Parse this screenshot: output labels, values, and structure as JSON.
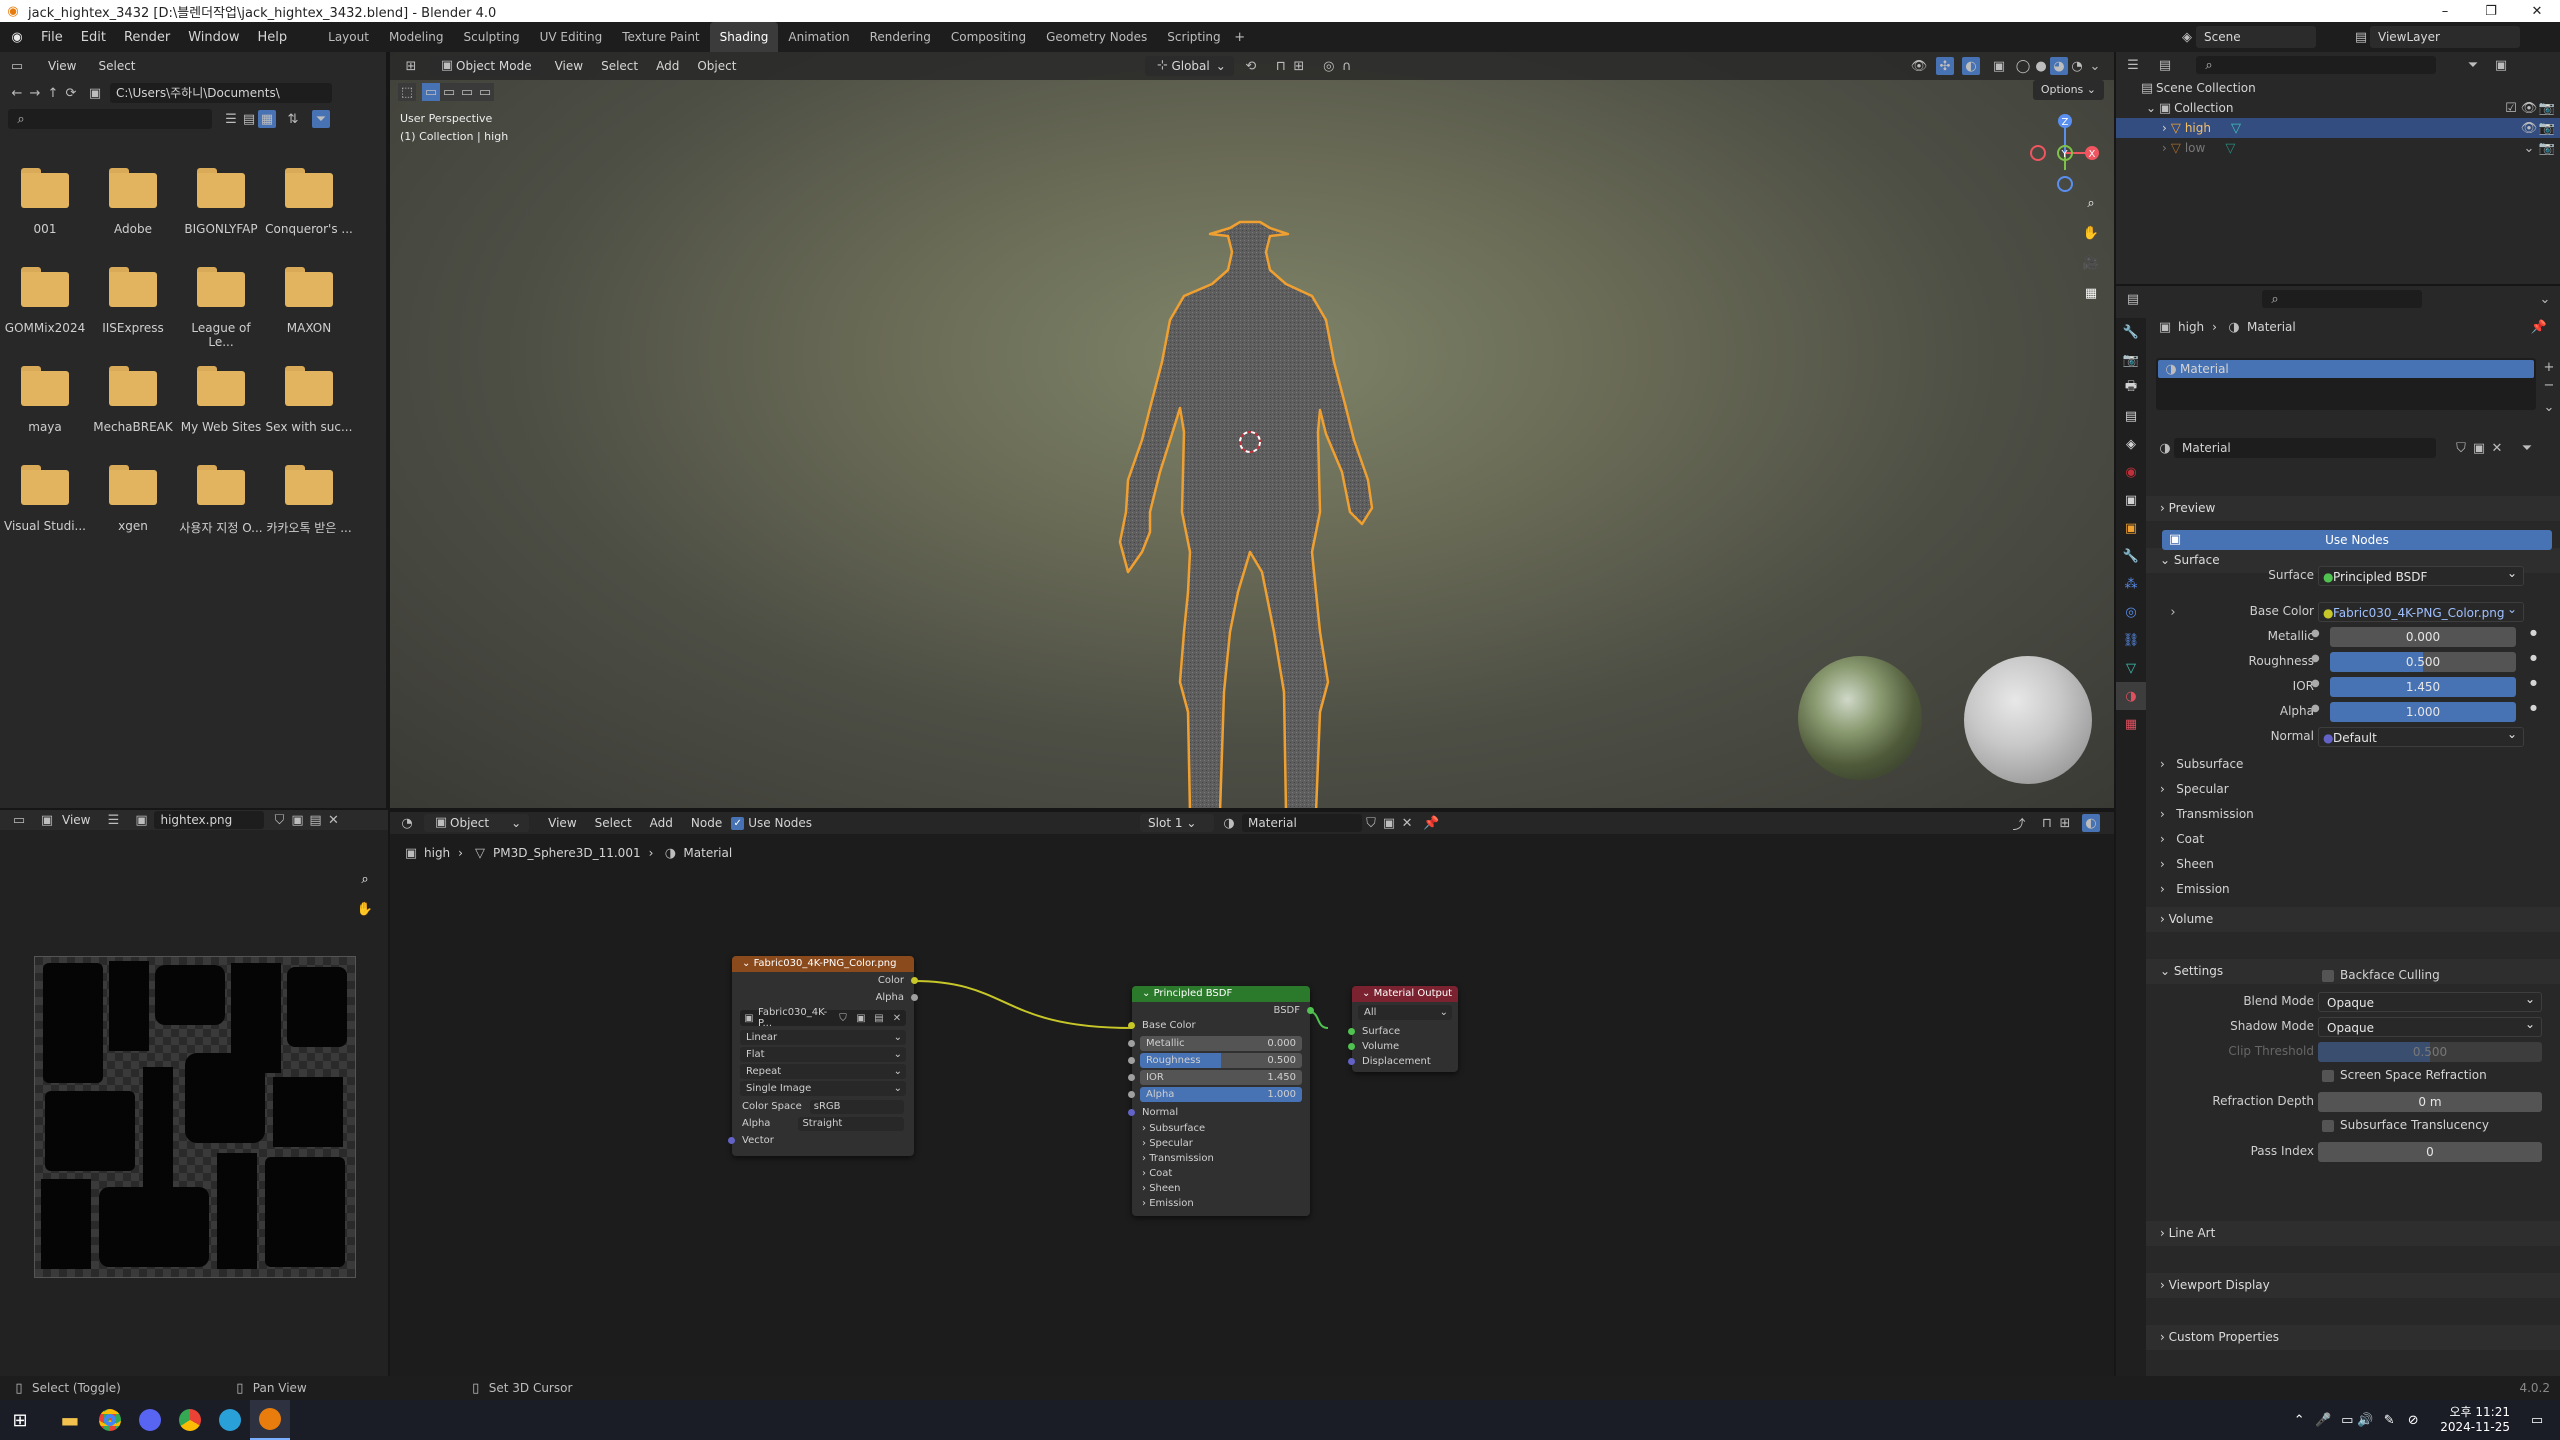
{
  "titlebar": {
    "title": "jack_hightex_3432 [D:\\블렌더작업\\jack_hightex_3432.blend] - Blender 4.0"
  },
  "menu": {
    "items": [
      "File",
      "Edit",
      "Render",
      "Window",
      "Help"
    ]
  },
  "workspaces": [
    "Layout",
    "Modeling",
    "Sculpting",
    "UV Editing",
    "Texture Paint",
    "Shading",
    "Animation",
    "Rendering",
    "Compositing",
    "Geometry Nodes",
    "Scripting"
  ],
  "active_workspace": "Shading",
  "topright": {
    "scene": "Scene",
    "view_layer": "ViewLayer"
  },
  "filebrowser": {
    "menu": [
      "View",
      "Select"
    ],
    "path": "C:\\Users\\주하니\\Documents\\",
    "folders": [
      "001",
      "Adobe",
      "BIGONLYFAP",
      "Conqueror's ...",
      "GOMMix2024",
      "IISExpress",
      "League of Le...",
      "MAXON",
      "maya",
      "MechaBREAK",
      "My Web Sites",
      "Sex with suc...",
      "Visual Studi...",
      "xgen",
      "사용자 지정 O...",
      "카카오톡 받은 ..."
    ]
  },
  "viewport": {
    "mode": "Object Mode",
    "menu": [
      "View",
      "Select",
      "Add",
      "Object"
    ],
    "transform": "Global",
    "info_line1": "User Perspective",
    "info_line2": "(1) Collection | high",
    "options": "Options",
    "gizmo": {
      "x": "X",
      "y": "Y",
      "z": "Z"
    }
  },
  "imageeditor": {
    "menu": "View",
    "image_name": "hightex.png"
  },
  "nodeeditor": {
    "mode": "Object",
    "menu": [
      "View",
      "Select",
      "Add",
      "Node"
    ],
    "use_nodes": "Use Nodes",
    "slot": "Slot 1",
    "material": "Material",
    "breadcrumb": [
      "high",
      "PM3D_Sphere3D_11.001",
      "Material"
    ],
    "image_node": {
      "title": "Fabric030_4K-PNG_Color.png",
      "out_color": "Color",
      "out_alpha": "Alpha",
      "image": "Fabric030_4K-P...",
      "interpolation": "Linear",
      "projection": "Flat",
      "extension": "Repeat",
      "source": "Single Image",
      "colorspace_label": "Color Space",
      "colorspace": "sRGB",
      "alpha_label": "Alpha",
      "alpha": "Straight",
      "in_vector": "Vector"
    },
    "bsdf_node": {
      "title": "Principled BSDF",
      "out": "BSDF",
      "base_color": "Base Color",
      "metallic_label": "Metallic",
      "metallic": "0.000",
      "roughness_label": "Roughness",
      "roughness": "0.500",
      "ior_label": "IOR",
      "ior": "1.450",
      "alpha_label": "Alpha",
      "alpha": "1.000",
      "normal": "Normal",
      "panels": [
        "Subsurface",
        "Specular",
        "Transmission",
        "Coat",
        "Sheen",
        "Emission"
      ]
    },
    "output_node": {
      "title": "Material Output",
      "target": "All",
      "surface": "Surface",
      "volume": "Volume",
      "displacement": "Displacement"
    }
  },
  "outliner": {
    "root": "Scene Collection",
    "collection": "Collection",
    "objects": [
      "high",
      "low"
    ]
  },
  "properties": {
    "breadcrumb": [
      "high",
      "Material"
    ],
    "slot_name": "Material",
    "material_name": "Material",
    "sections": {
      "preview": "Preview",
      "surface": "Surface",
      "volume": "Volume",
      "settings": "Settings",
      "line_art": "Line Art",
      "viewport_display": "Viewport Display",
      "custom_props": "Custom Properties"
    },
    "use_nodes": "Use Nodes",
    "surface_label": "Surface",
    "surface_value": "Principled BSDF",
    "base_color_label": "Base Color",
    "base_color_value": "Fabric030_4K-PNG_Color.png",
    "metallic_label": "Metallic",
    "metallic": "0.000",
    "roughness_label": "Roughness",
    "roughness": "0.500",
    "ior_label": "IOR",
    "ior": "1.450",
    "alpha_label": "Alpha",
    "alpha": "1.000",
    "normal_label": "Normal",
    "normal": "Default",
    "subpanels": [
      "Subsurface",
      "Specular",
      "Transmission",
      "Coat",
      "Sheen",
      "Emission"
    ],
    "settings": {
      "backface": "Backface Culling",
      "blend_mode_label": "Blend Mode",
      "blend_mode": "Opaque",
      "shadow_mode_label": "Shadow Mode",
      "shadow_mode": "Opaque",
      "clip_label": "Clip Threshold",
      "clip": "0.500",
      "ssr": "Screen Space Refraction",
      "refraction_depth_label": "Refraction Depth",
      "refraction_depth": "0 m",
      "sst": "Subsurface Translucency",
      "pass_index_label": "Pass Index",
      "pass_index": "0"
    }
  },
  "statusbar": {
    "left": "Select (Toggle)",
    "mid": "Pan View",
    "right_hint": "Set 3D Cursor",
    "version": "4.0.2"
  },
  "taskbar": {
    "time": "오후 11:21",
    "date": "2024-11-25"
  },
  "colors": {
    "accent": "#4772b3",
    "selection_outline": "#f0a030",
    "image_node": "#8a4a1c",
    "bsdf_node": "#2b7a2b",
    "output_node": "#7a2230"
  }
}
